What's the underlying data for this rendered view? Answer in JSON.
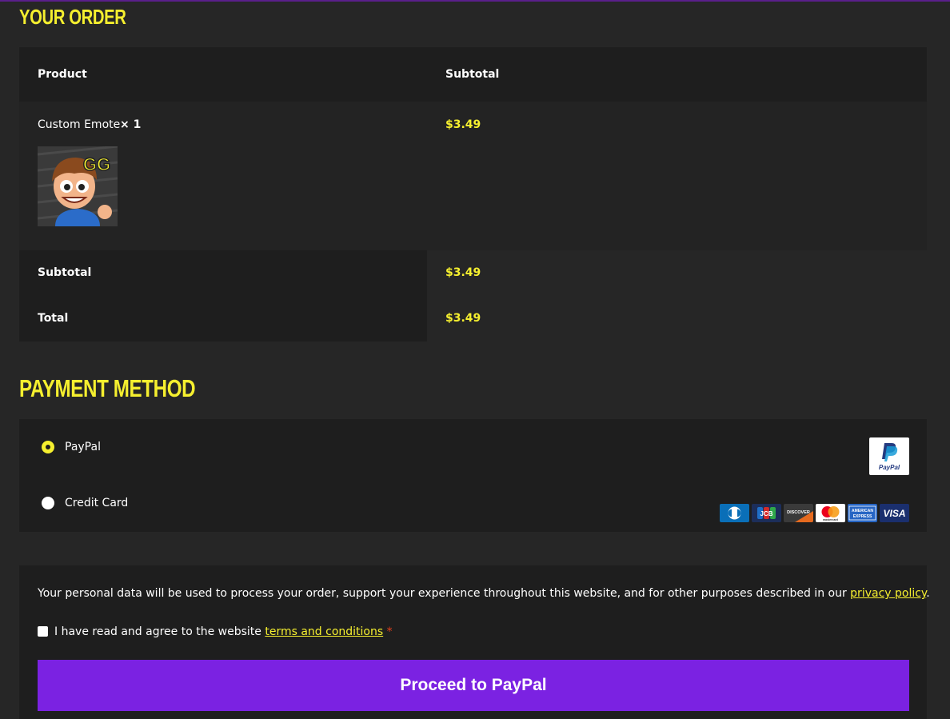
{
  "order": {
    "heading": "Your Order",
    "columns": [
      "Product",
      "Subtotal"
    ],
    "item": {
      "name": "Custom Emote",
      "qty": "× 1",
      "price": "$3.49",
      "image_text": "GG"
    },
    "subtotal_label": "Subtotal",
    "subtotal_value": "$3.49",
    "total_label": "Total",
    "total_value": "$3.49"
  },
  "payment": {
    "heading": "Payment Method",
    "options": [
      {
        "label": "PayPal",
        "selected": true,
        "icon": "paypal-icon"
      },
      {
        "label": "Credit Card",
        "selected": false,
        "icon": "credit-cards-icon"
      }
    ],
    "paypal_badge": "PayPal",
    "cards": [
      "Diners",
      "JCB",
      "DISCOVER",
      "mastercard",
      "AMERICAN EXPRESS",
      "VISA"
    ]
  },
  "privacy": {
    "text": "Your personal data will be used to process your order, support your experience throughout this website, and for other purposes described in our ",
    "link": "privacy policy",
    "end": ".",
    "terms_prefix": "I have read and agree to the website ",
    "terms_link": "terms and conditions",
    "required_mark": "*"
  },
  "button": {
    "label": "Proceed to PayPal"
  },
  "colors": {
    "accent": "#f5ef2f",
    "button": "#7b22e2",
    "background": "#262626",
    "panel": "#1e1e1e",
    "required": "#e2401c"
  }
}
